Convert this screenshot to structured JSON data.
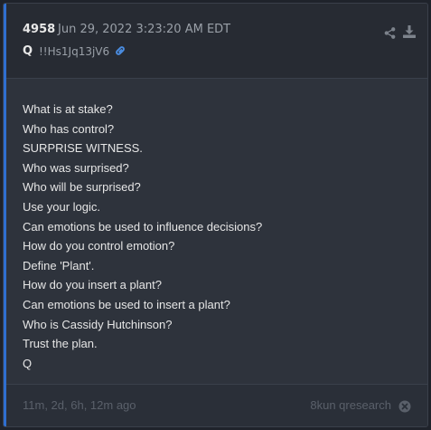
{
  "post": {
    "number": "4958",
    "date": "Jun 29, 2022 3:23:20 AM EDT",
    "author": "Q",
    "tripcode": "!!Hs1Jq13jV6"
  },
  "header_icons": {
    "link": "link-icon",
    "share": "share-icon",
    "download": "download-icon"
  },
  "message_lines": [
    "What is at stake?",
    "Who has control?",
    "SURPRISE WITNESS.",
    "Who was surprised?",
    "Who will be surprised?",
    "Use your logic.",
    "Can emotions be used to influence decisions?",
    "How do you control emotion?",
    "Define 'Plant'.",
    "How do you insert a plant?",
    "Can emotions be used to insert a plant?",
    "Who is Cassidy Hutchinson?",
    "Trust the plan.",
    "Q"
  ],
  "footer": {
    "time_ago": "11m, 2d, 6h, 12m ago",
    "source": "8kun qresearch",
    "close_icon": "close-circle-icon"
  },
  "colors": {
    "accent": "#2f6fd0",
    "link_icon": "#4a8ce0",
    "text": "#e6e6e6",
    "muted": "#9aa0a8"
  }
}
